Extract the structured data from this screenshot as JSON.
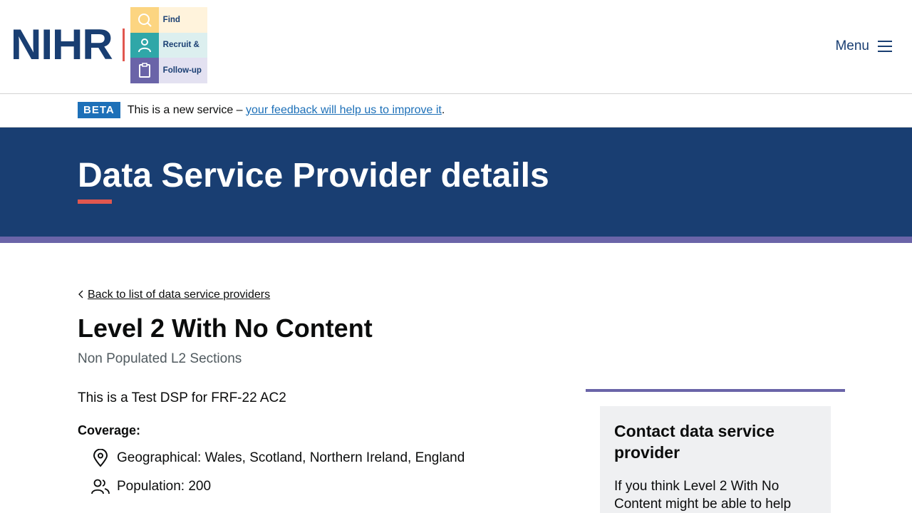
{
  "header": {
    "logo_text": "NIHR",
    "tiles": [
      {
        "label": "Find",
        "icon": "search-icon"
      },
      {
        "label": "Recruit &",
        "icon": "person-icon"
      },
      {
        "label": "Follow-up",
        "icon": "clipboard-icon"
      }
    ],
    "menu_label": "Menu",
    "colors": {
      "brand_navy": "#193e72",
      "accent_red": "#e1574f",
      "purple": "#6a64a8",
      "teal": "#2fa7a8",
      "yellow": "#fcd581"
    }
  },
  "beta": {
    "tag": "BETA",
    "text": "This is a new service –",
    "link": "your feedback will help us to improve it",
    "suffix": "."
  },
  "hero": {
    "title": "Data Service Provider details"
  },
  "main": {
    "back_link": "Back to list of data service providers",
    "title": "Level 2 With No Content",
    "subtitle": "Non Populated L2 Sections",
    "description": "This is a Test DSP for FRF-22 AC2",
    "coverage_label": "Coverage:",
    "coverage": [
      {
        "icon": "location-pin-icon",
        "text": "Geographical: Wales, Scotland, Northern Ireland, England"
      },
      {
        "icon": "people-icon",
        "text": "Population: 200"
      }
    ]
  },
  "sidebar": {
    "contact_title": "Contact data service provider",
    "contact_body": "If you think Level 2 With No Content might be able to help"
  }
}
